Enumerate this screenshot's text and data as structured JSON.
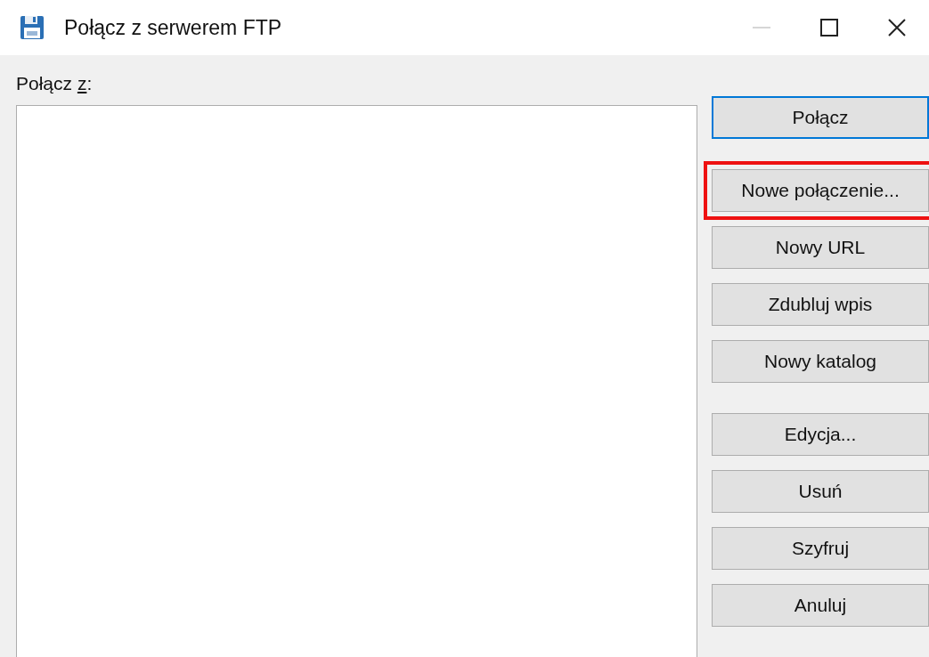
{
  "window": {
    "title": "Połącz z serwerem FTP",
    "minimize_disabled": true
  },
  "connect_from": {
    "label": "Połącz ",
    "access_key": "z",
    "suffix": ":"
  },
  "button_groups": [
    [
      {
        "label": "Połącz",
        "default": true,
        "highlighted": false
      }
    ],
    [
      {
        "label": "Nowe połączenie...",
        "default": false,
        "highlighted": true
      },
      {
        "label": "Nowy URL",
        "default": false,
        "highlighted": false
      },
      {
        "label": "Zdubluj wpis",
        "default": false,
        "highlighted": false
      },
      {
        "label": "Nowy katalog",
        "default": false,
        "highlighted": false
      }
    ],
    [
      {
        "label": "Edycja...",
        "default": false,
        "highlighted": false
      },
      {
        "label": "Usuń",
        "default": false,
        "highlighted": false
      },
      {
        "label": "Szyfruj",
        "default": false,
        "highlighted": false
      },
      {
        "label": "Anuluj",
        "default": false,
        "highlighted": false
      }
    ]
  ]
}
